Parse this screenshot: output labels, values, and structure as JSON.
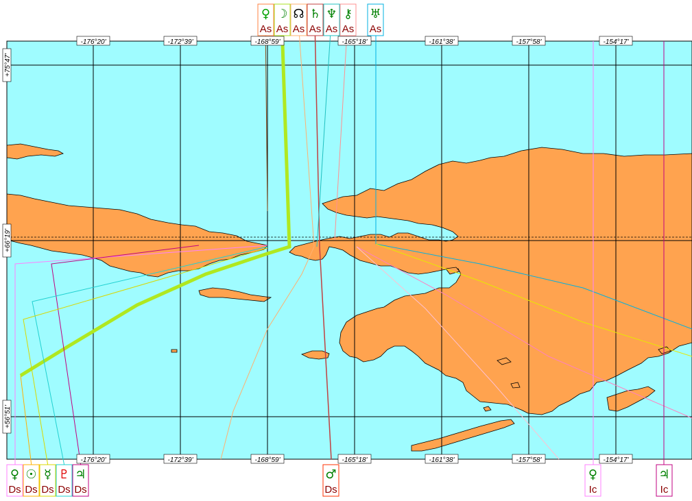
{
  "map": {
    "colors": {
      "sea": "#9ffcff",
      "land": "#ffa34f",
      "grid": "#000000",
      "outline": "#000000"
    },
    "longitude_labels": [
      "-176°20'",
      "-172°39'",
      "-168°59'",
      "-165°18'",
      "-161°38'",
      "-157°58'",
      "-154°17'"
    ],
    "latitude_labels": [
      "+75°47'",
      "+66°19'",
      "+56°51'"
    ]
  },
  "top_markers": [
    {
      "glyph": "♀",
      "tag": "As",
      "planet": "venus",
      "color": "#00a000"
    },
    {
      "glyph": "☽",
      "tag": "As",
      "planet": "moon",
      "color": "#a8e020"
    },
    {
      "glyph": "☊",
      "tag": "As",
      "planet": "node",
      "color": "#000000"
    },
    {
      "glyph": "♄",
      "tag": "As",
      "planet": "saturn",
      "color": "#00a000"
    },
    {
      "glyph": "♆",
      "tag": "As",
      "planet": "neptune",
      "color": "#00a000"
    },
    {
      "glyph": "⚷",
      "tag": "As",
      "planet": "chiron",
      "color": "#00a000"
    },
    {
      "glyph": "♅",
      "tag": "As",
      "planet": "uranus",
      "color": "#00a000"
    }
  ],
  "bottom_markers": [
    {
      "glyph": "♀",
      "tag": "Ds",
      "planet": "venus",
      "color": "#ff80ff"
    },
    {
      "glyph": "☉",
      "tag": "Ds",
      "planet": "sun",
      "color": "#ffb000"
    },
    {
      "glyph": "☿",
      "tag": "Ds",
      "planet": "mercury",
      "color": "#d0d000"
    },
    {
      "glyph": "♇",
      "tag": "Ds",
      "planet": "pluto",
      "color": "#00d0d0"
    },
    {
      "glyph": "♃",
      "tag": "Ds",
      "planet": "jupiter",
      "color": "#c00080"
    },
    {
      "glyph": "♂",
      "tag": "Ds",
      "planet": "mars",
      "color": "#ff3000"
    },
    {
      "glyph": "♀",
      "tag": "Ic",
      "planet": "venus",
      "color": "#ff80ff"
    },
    {
      "glyph": "♃",
      "tag": "Ic",
      "planet": "jupiter",
      "color": "#c00080"
    }
  ]
}
